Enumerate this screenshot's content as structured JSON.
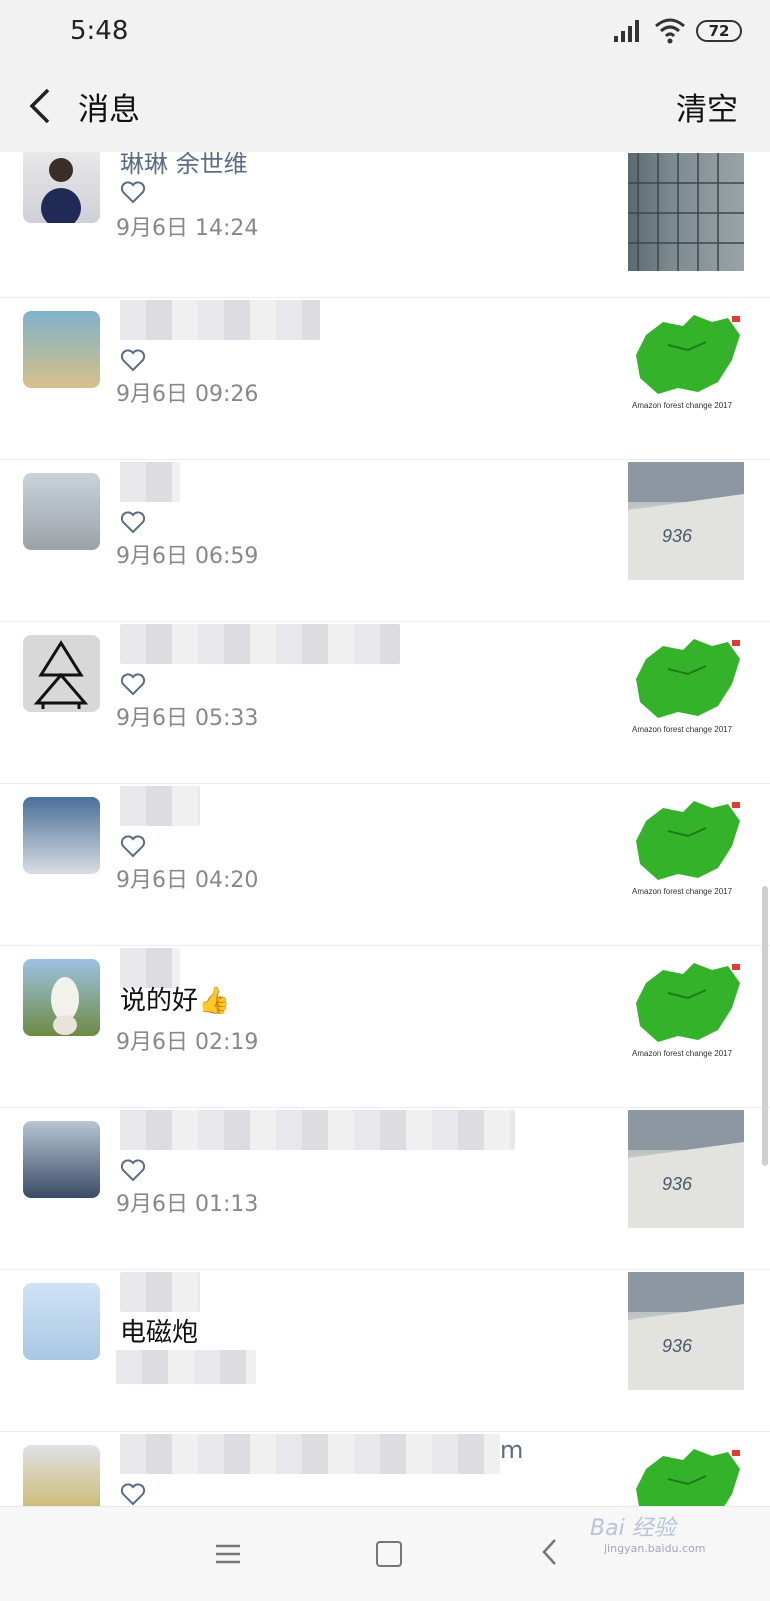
{
  "status": {
    "time": "5:48",
    "battery": "72"
  },
  "header": {
    "title": "消息",
    "clear": "清空"
  },
  "rows": [
    {
      "name": "琳琳 余世维",
      "time": "9月6日 14:24",
      "text": "",
      "liked": true,
      "thumb": "building"
    },
    {
      "name": "",
      "time": "9月6日 09:26",
      "text": "",
      "liked": true,
      "thumb": "map"
    },
    {
      "name": "",
      "time": "9月6日 06:59",
      "text": "",
      "liked": true,
      "thumb": "ship"
    },
    {
      "name": "",
      "time": "9月6日 05:33",
      "text": "",
      "liked": true,
      "thumb": "map"
    },
    {
      "name": "",
      "time": "9月6日 04:20",
      "text": "",
      "liked": true,
      "thumb": "map"
    },
    {
      "name": "",
      "time": "9月6日 02:19",
      "text": "说的好👍",
      "liked": false,
      "thumb": "map"
    },
    {
      "name": "",
      "time": "9月6日 01:13",
      "text": "",
      "liked": true,
      "thumb": "ship"
    },
    {
      "name": "",
      "time": "",
      "text": "电磁炮",
      "liked": false,
      "thumb": "ship"
    },
    {
      "name": "m",
      "time": "",
      "text": "",
      "liked": true,
      "thumb": "map"
    }
  ],
  "map_caption": "Amazon forest change 2017",
  "ship_number": "936",
  "watermark": {
    "brand": "Bai 经验",
    "url": "jingyan.baidu.com"
  }
}
